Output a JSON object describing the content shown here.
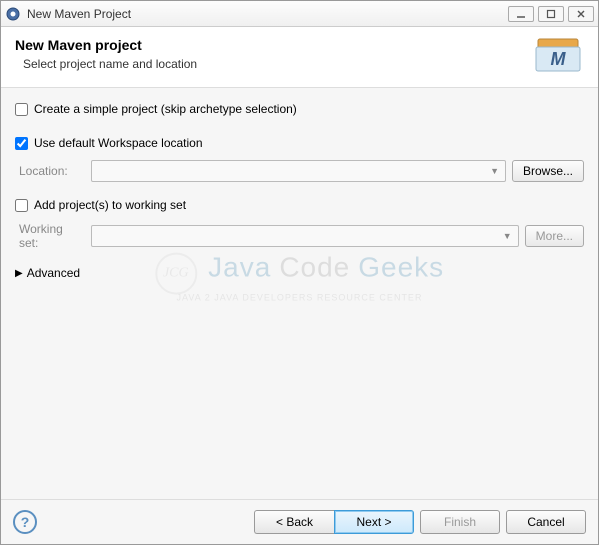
{
  "window": {
    "title": "New Maven Project"
  },
  "banner": {
    "heading": "New Maven project",
    "subtitle": "Select project name and location"
  },
  "options": {
    "simple_project": {
      "label": "Create a simple project (skip archetype selection)",
      "checked": false
    },
    "default_ws": {
      "label": "Use default Workspace location",
      "checked": true
    },
    "location_label": "Location:",
    "location_value": "",
    "browse_label": "Browse...",
    "working_set": {
      "label": "Add project(s) to working set",
      "checked": false
    },
    "working_set_label": "Working set:",
    "working_set_value": "",
    "more_label": "More...",
    "advanced_label": "Advanced"
  },
  "watermark": {
    "badge": "JCG",
    "t1": "Java",
    "t2": "Code",
    "t3": "Geeks",
    "tag": "Java 2 Java Developers Resource Center"
  },
  "footer": {
    "back": "< Back",
    "next": "Next >",
    "finish": "Finish",
    "cancel": "Cancel"
  }
}
